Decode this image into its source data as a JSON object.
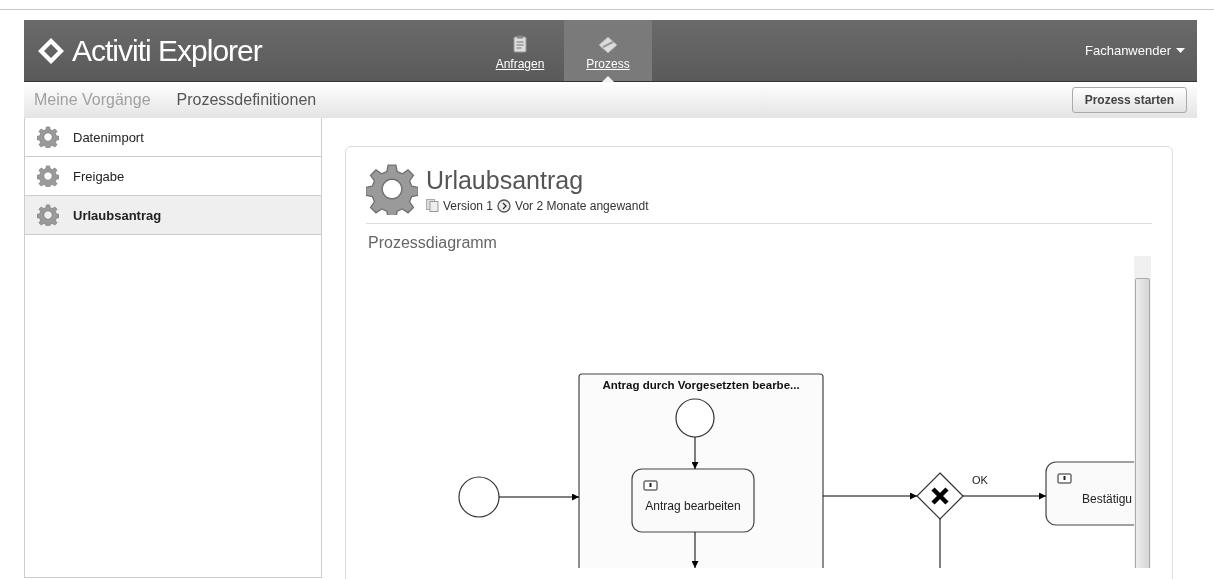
{
  "header": {
    "logo": "Activiti Explorer",
    "nav": [
      {
        "label": "Anfragen",
        "kind": "clipboard",
        "selected": false
      },
      {
        "label": "Prozess",
        "kind": "diamond",
        "selected": true
      }
    ],
    "user_menu": "Fachanwender"
  },
  "subnav": {
    "items": [
      {
        "label": "Meine Vorgänge",
        "selected": false
      },
      {
        "label": "Prozessdefinitionen",
        "selected": true
      }
    ],
    "action": "Prozess starten"
  },
  "sidebar": {
    "items": [
      {
        "label": "Datenimport",
        "selected": false
      },
      {
        "label": "Freigabe",
        "selected": false
      },
      {
        "label": "Urlaubsantrag",
        "selected": true
      }
    ]
  },
  "detail": {
    "title": "Urlaubsantrag",
    "version": "Version 1",
    "deployed": "Vor 2 Monate angewandt",
    "section": "Prozessdiagramm",
    "diagram": {
      "nodes": [
        {
          "kind": "start"
        },
        {
          "kind": "subprocess",
          "label": "Antrag durch Vorgesetzten bearbe..."
        },
        {
          "kind": "start"
        },
        {
          "kind": "task",
          "label": "Antrag bearbeiten"
        },
        {
          "kind": "gateway"
        },
        {
          "kind": "task",
          "label": "Bestätigu"
        }
      ],
      "flows": [
        {
          "label": "OK"
        }
      ]
    }
  }
}
